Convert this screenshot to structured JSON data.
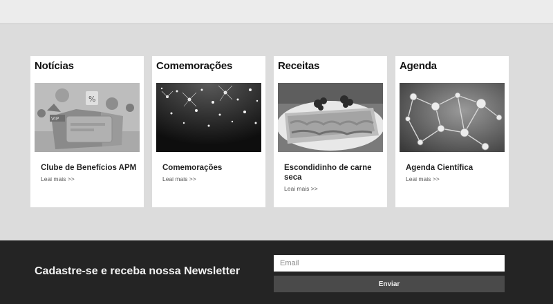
{
  "sections": [
    {
      "heading": "Notícias",
      "thumb_icon": "discount-card-illustration",
      "item_title": "Clube de Benefícios APM",
      "read_more": "Leai mais >>"
    },
    {
      "heading": "Comemorações",
      "thumb_icon": "fireworks-photo",
      "item_title": "Comemorações",
      "read_more": "Leai mais >>"
    },
    {
      "heading": "Receitas",
      "thumb_icon": "food-dish-photo",
      "item_title": "Escondidinho de carne seca",
      "read_more": "Leai mais >>"
    },
    {
      "heading": "Agenda",
      "thumb_icon": "molecule-network-photo",
      "item_title": "Agenda Científica",
      "read_more": "Leai mais >>"
    }
  ],
  "newsletter": {
    "title": "Cadastre-se e receba nossa Newsletter",
    "email_placeholder": "Email",
    "submit_label": "Enviar"
  },
  "colors": {
    "page_bg": "#dcdcdc",
    "card_bg": "#ffffff",
    "footer_bg": "#242424",
    "button_bg": "#4a4a4a"
  }
}
